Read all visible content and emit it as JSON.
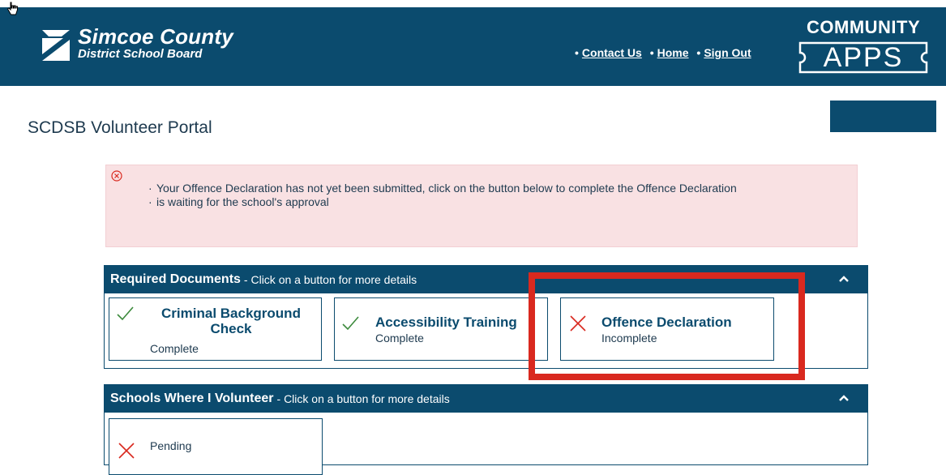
{
  "header": {
    "org_line1": "Simcoe County",
    "org_line2": "District School Board",
    "nav": [
      {
        "label": "Contact Us"
      },
      {
        "label": "Home"
      },
      {
        "label": "Sign Out"
      }
    ],
    "apps_top": "COMMUNITY",
    "apps_word": "APPS"
  },
  "page": {
    "title": "SCDSB Volunteer Portal"
  },
  "alert": {
    "messages": [
      "Your Offence Declaration has not yet been submitted, click on the button below to complete the Offence Declaration",
      "is waiting for the school's approval"
    ]
  },
  "required_documents": {
    "title": "Required Documents",
    "subtitle": "- Click on a button for more details",
    "items": [
      {
        "title": "Criminal Background Check",
        "status": "Complete",
        "state": "complete"
      },
      {
        "title": "Accessibility Training",
        "status": "Complete",
        "state": "complete"
      },
      {
        "title": "Offence Declaration",
        "status": "Incomplete",
        "state": "incomplete"
      }
    ]
  },
  "schools": {
    "title": "Schools Where I Volunteer",
    "subtitle": "- Click on a button for more details",
    "items": [
      {
        "status": "Pending",
        "state": "incomplete"
      }
    ]
  },
  "colors": {
    "brand": "#0b4b6e",
    "check": "#3c8a3c",
    "cross": "#d9291f",
    "alert_bg": "#f9e1e3",
    "highlight": "#d9291f"
  }
}
